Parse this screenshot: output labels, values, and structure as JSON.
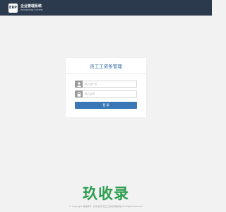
{
  "header": {
    "logo_mark": "ERP",
    "logo_name": "企业管理系统",
    "logo_sub": "ENTERPRISE SYSTEM"
  },
  "login": {
    "title": "员工工资条管理",
    "username_placeholder": "输入用户名",
    "password_placeholder": "输入密码",
    "submit_label": "登 录"
  },
  "watermark": "玖收录",
  "footer": "© Copyright 版权所有 · 技术支持 员工工资条管理系统 All Rights Reserved"
}
